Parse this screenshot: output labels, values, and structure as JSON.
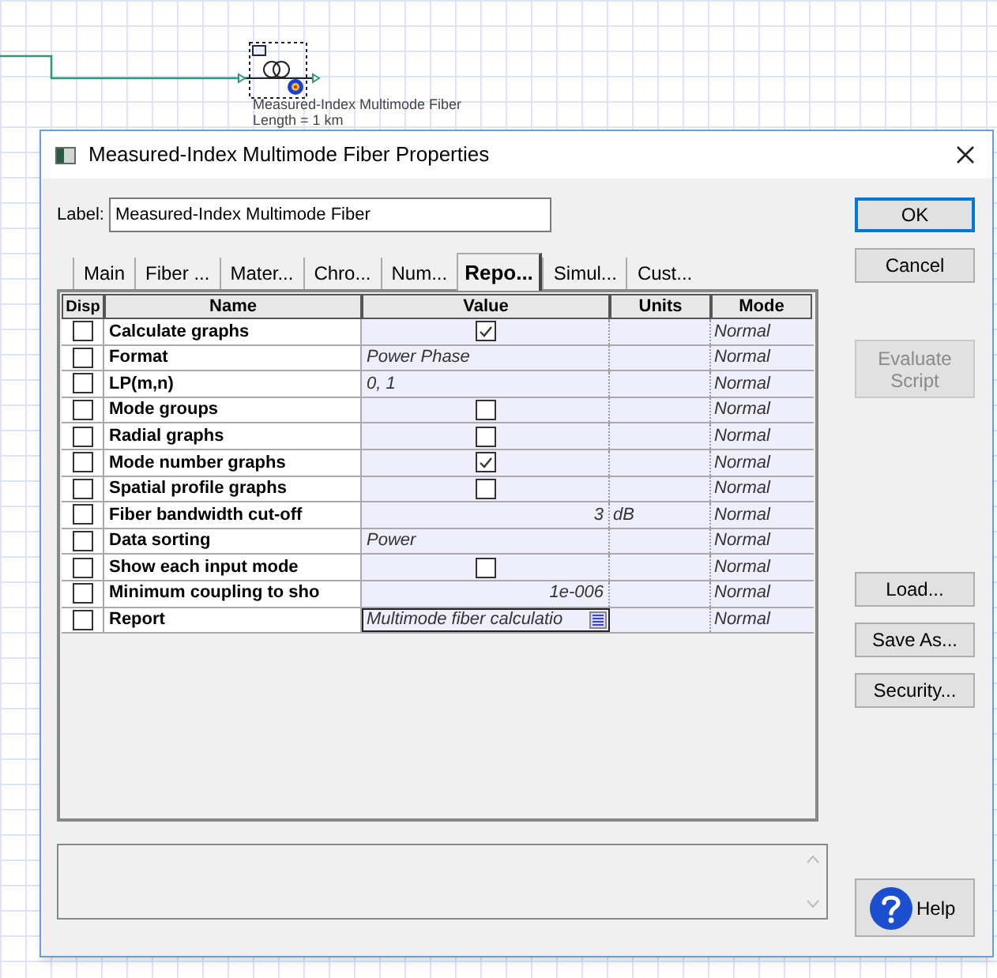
{
  "canvas": {
    "component": {
      "caption": "Measured-Index Multimode Fiber",
      "caption_2": "Length = 1  km"
    }
  },
  "dialog": {
    "title": "Measured-Index Multimode Fiber Properties",
    "label": {
      "caption": "Label:",
      "value": "Measured-Index Multimode Fiber"
    },
    "tabs": [
      {
        "label": "Main",
        "selected": false
      },
      {
        "label": "Fiber ...",
        "selected": false
      },
      {
        "label": "Mater...",
        "selected": false
      },
      {
        "label": "Chro...",
        "selected": false
      },
      {
        "label": "Num...",
        "selected": false
      },
      {
        "label": "Repo...",
        "selected": true
      },
      {
        "label": "Simul...",
        "selected": false
      },
      {
        "label": "Cust...",
        "selected": false
      }
    ],
    "table": {
      "columns": [
        "Disp",
        "Name",
        "Value",
        "Units",
        "Mode"
      ],
      "rows": [
        {
          "disp": false,
          "name": "Calculate graphs",
          "kind": "checkbox",
          "checked": true,
          "mode": "Normal"
        },
        {
          "disp": false,
          "name": "Format",
          "kind": "text",
          "value": "Power Phase",
          "mode": "Normal"
        },
        {
          "disp": false,
          "name": "LP(m,n)",
          "kind": "text",
          "value": "0, 1",
          "mode": "Normal"
        },
        {
          "disp": false,
          "name": "Mode groups",
          "kind": "checkbox",
          "checked": false,
          "mode": "Normal"
        },
        {
          "disp": false,
          "name": "Radial graphs",
          "kind": "checkbox",
          "checked": false,
          "mode": "Normal"
        },
        {
          "disp": false,
          "name": "Mode number graphs",
          "kind": "checkbox",
          "checked": true,
          "mode": "Normal"
        },
        {
          "disp": false,
          "name": "Spatial profile graphs",
          "kind": "checkbox",
          "checked": false,
          "mode": "Normal"
        },
        {
          "disp": false,
          "name": "Fiber bandwidth cut-off",
          "kind": "number",
          "value": "3",
          "units": "dB",
          "mode": "Normal"
        },
        {
          "disp": false,
          "name": "Data sorting",
          "kind": "text",
          "value": "Power",
          "mode": "Normal"
        },
        {
          "disp": false,
          "name": "Show each input mode",
          "kind": "checkbox",
          "checked": false,
          "mode": "Normal"
        },
        {
          "disp": false,
          "name": "Minimum coupling to sho",
          "kind": "number",
          "value": "1e-006",
          "mode": "Normal"
        },
        {
          "disp": false,
          "name": "Report",
          "kind": "dropdown",
          "value": "Multimode fiber calculatio",
          "mode": "Normal"
        }
      ]
    },
    "buttons": [
      {
        "label": "OK",
        "kind": "default",
        "disabled": false
      },
      {
        "label": "Cancel",
        "kind": "normal",
        "disabled": false
      },
      {
        "label": "Evaluate Script",
        "kind": "normal",
        "disabled": true
      },
      {
        "label": "Load...",
        "kind": "normal",
        "disabled": false
      },
      {
        "label": "Save As...",
        "kind": "normal",
        "disabled": false
      },
      {
        "label": "Security...",
        "kind": "normal",
        "disabled": false
      }
    ],
    "help_button": "Help"
  }
}
